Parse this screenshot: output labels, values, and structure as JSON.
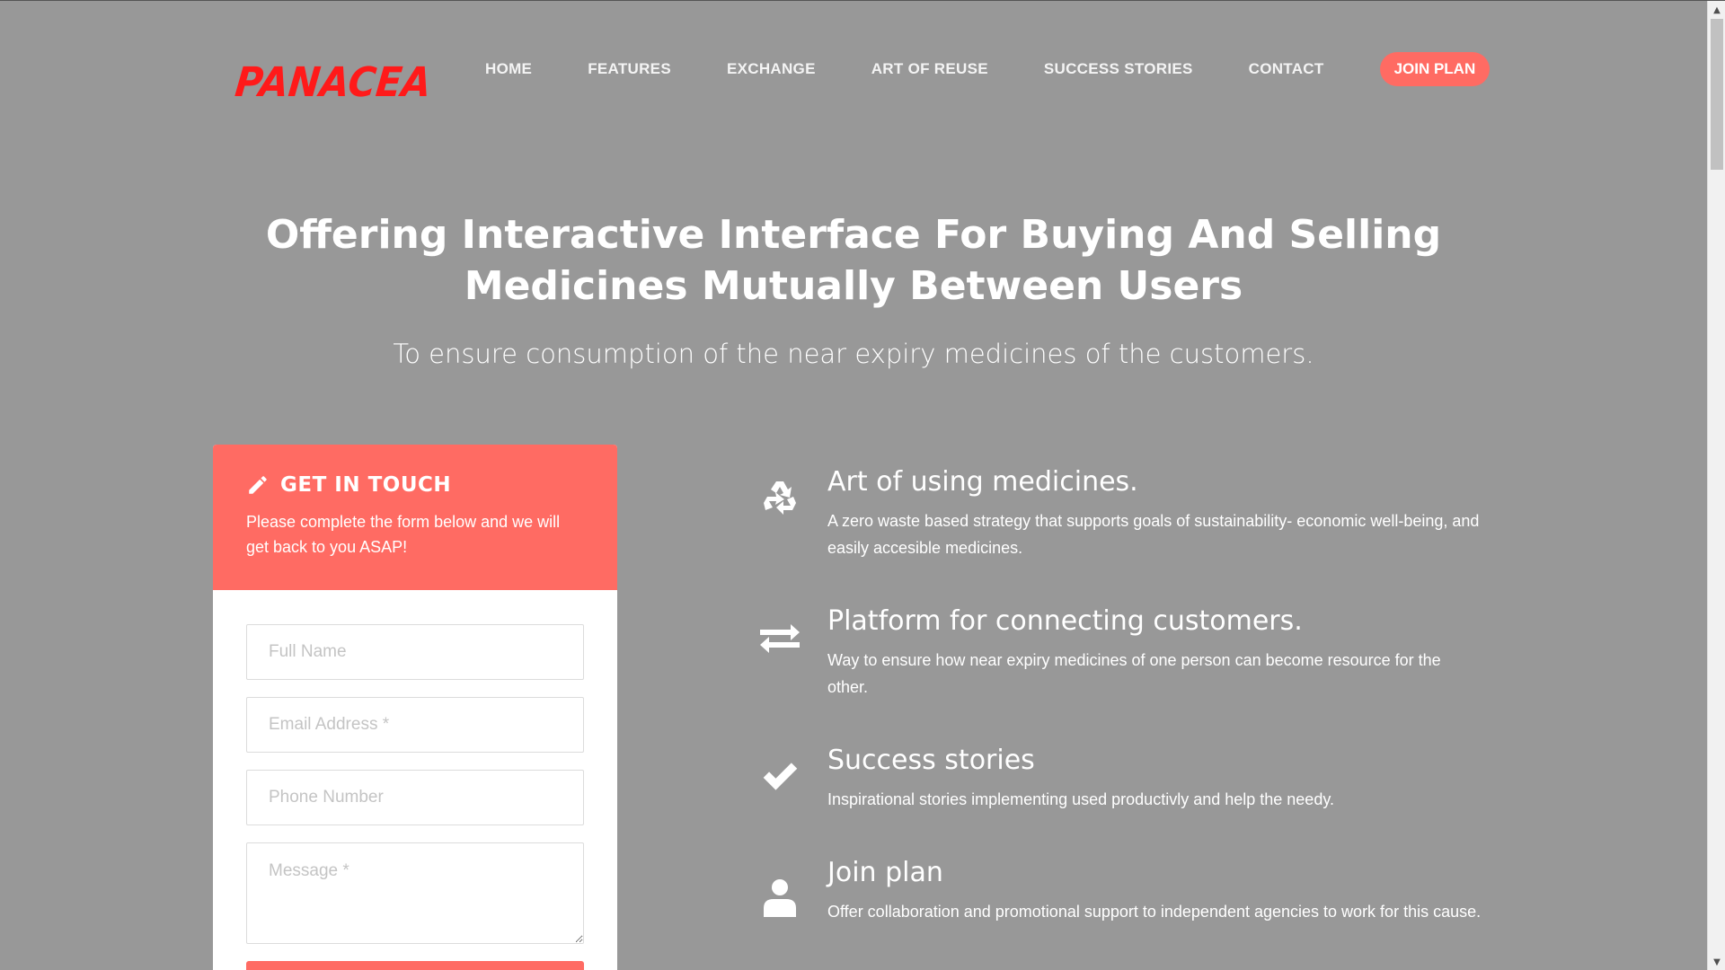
{
  "header": {
    "logo": "PANACEA",
    "nav": [
      {
        "label": "HOME"
      },
      {
        "label": "FEATURES"
      },
      {
        "label": "EXCHANGE"
      },
      {
        "label": "ART OF REUSE"
      },
      {
        "label": "SUCCESS STORIES"
      },
      {
        "label": "CONTACT"
      }
    ],
    "cta": "JOIN PLAN"
  },
  "hero": {
    "title_line1": "Offering Interactive Interface For Buying And Selling",
    "title_line2": "Medicines Mutually Between Users",
    "subtitle": "To ensure consumption of the near expiry medicines of the customers."
  },
  "contact_form": {
    "title": "GET IN TOUCH",
    "description": "Please complete the form below and we will get back to you ASAP!",
    "fields": {
      "full_name_placeholder": "Full Name",
      "email_placeholder": "Email Address *",
      "phone_placeholder": "Phone Number",
      "message_placeholder": "Message *"
    },
    "icon": "pencil-icon"
  },
  "features": [
    {
      "icon": "recycle-icon",
      "title": "Art of using medicines.",
      "description": "A zero waste based strategy that supports goals of sustainability- economic well-being, and easily accesible medicines."
    },
    {
      "icon": "exchange-icon",
      "title": "Platform for connecting customers.",
      "description": "Way to ensure how near expiry medicines of one person can become resource for the other."
    },
    {
      "icon": "check-icon",
      "title": "Success stories",
      "description": "Inspirational stories implementing used productivly and help the needy."
    },
    {
      "icon": "user-icon",
      "title": "Join plan",
      "description": "Offer collaboration and promotional support to independent agencies to work for this cause."
    }
  ],
  "colors": {
    "background": "#989898",
    "accent": "#ff6b63",
    "logo": "#ff1a1a"
  }
}
